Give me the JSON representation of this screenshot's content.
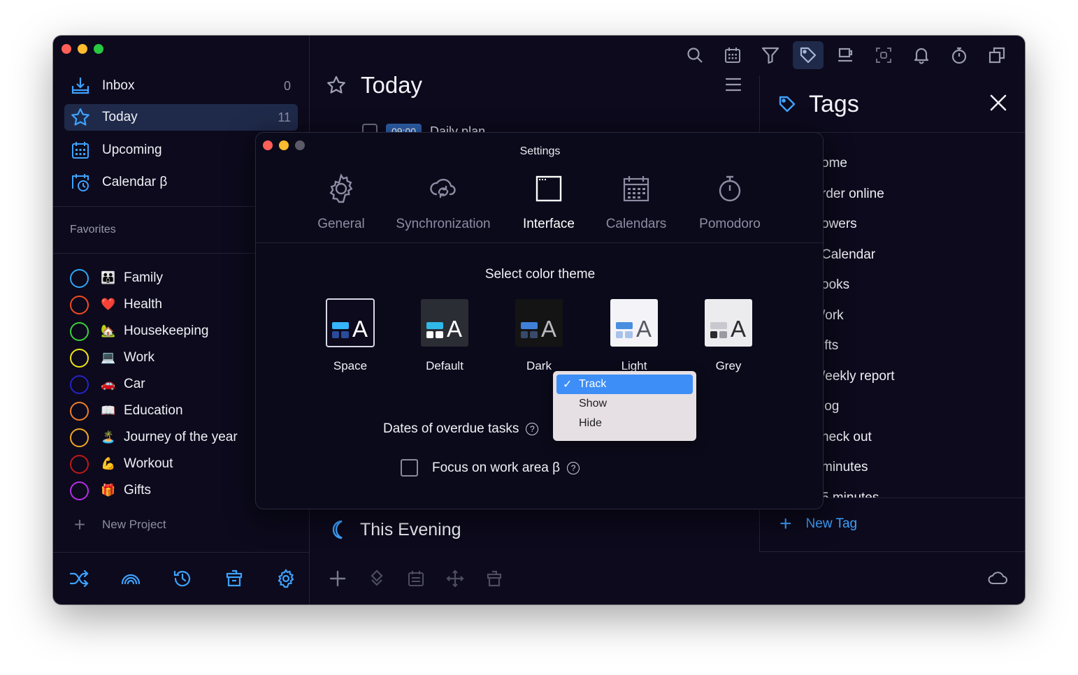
{
  "sidebar": {
    "nav": [
      {
        "label": "Inbox",
        "count": "0",
        "icon": "inbox-icon"
      },
      {
        "label": "Today",
        "count": "11",
        "icon": "star-icon"
      },
      {
        "label": "Upcoming",
        "count": "",
        "icon": "calendar-grid-icon"
      },
      {
        "label": "Calendar β",
        "count": "",
        "icon": "calendar-clock-icon"
      }
    ],
    "favorites_title": "Favorites",
    "projects": [
      {
        "label": "Family",
        "emoji": "👪",
        "color": "#2fa5f5"
      },
      {
        "label": "Health",
        "emoji": "❤️",
        "color": "#f24b22"
      },
      {
        "label": "Housekeeping",
        "emoji": "🏡",
        "color": "#3ecf3e"
      },
      {
        "label": "Work",
        "emoji": "💻",
        "color": "#f1e31a"
      },
      {
        "label": "Car",
        "emoji": "🚗",
        "color": "#2424c8"
      },
      {
        "label": "Education",
        "emoji": "📖",
        "color": "#f07d2a"
      },
      {
        "label": "Journey of the year",
        "emoji": "🏝️",
        "color": "#f5a623"
      },
      {
        "label": "Workout",
        "emoji": "💪",
        "color": "#c01818"
      },
      {
        "label": "Gifts",
        "emoji": "🎁",
        "color": "#b52ee8"
      }
    ],
    "new_project": "New Project"
  },
  "main": {
    "title": "Today",
    "task": {
      "time": "09:00",
      "title": "Daily plan"
    },
    "evening": "This Evening"
  },
  "tags": {
    "title": "Tags",
    "items": [
      "ome",
      "rder online",
      "owers",
      "Calendar",
      "ooks",
      "/ork",
      "ifts",
      "/eekly report",
      "log",
      "heck out",
      "minutes",
      "5 minutes"
    ],
    "new_tag": "New Tag"
  },
  "settings": {
    "title": "Settings",
    "tabs": [
      {
        "label": "General",
        "icon": "gear-icon"
      },
      {
        "label": "Synchronization",
        "icon": "cloud-sync-icon"
      },
      {
        "label": "Interface",
        "icon": "window-icon"
      },
      {
        "label": "Calendars",
        "icon": "calendar-icon"
      },
      {
        "label": "Pomodoro",
        "icon": "stopwatch-icon"
      }
    ],
    "theme_title": "Select color theme",
    "themes": [
      {
        "label": "Space",
        "bg": "#0c0a1c"
      },
      {
        "label": "Default",
        "bg": "#2a2d33"
      },
      {
        "label": "Dark",
        "bg": "#141414"
      },
      {
        "label": "Light",
        "bg": "#f4f4f8"
      },
      {
        "label": "Grey",
        "bg": "#ececee"
      }
    ],
    "overdue_label": "Dates of overdue tasks",
    "overdue_options": [
      "Track",
      "Show",
      "Hide"
    ],
    "overdue_selected": "Track",
    "focus_label": "Focus on work area β",
    "help_glyph": "?"
  },
  "colors": {
    "background": "#0c0a1c",
    "accent": "#3ea2ff",
    "active_row": "#1f2a4a",
    "dropdown_selected": "#3d8ef7"
  }
}
